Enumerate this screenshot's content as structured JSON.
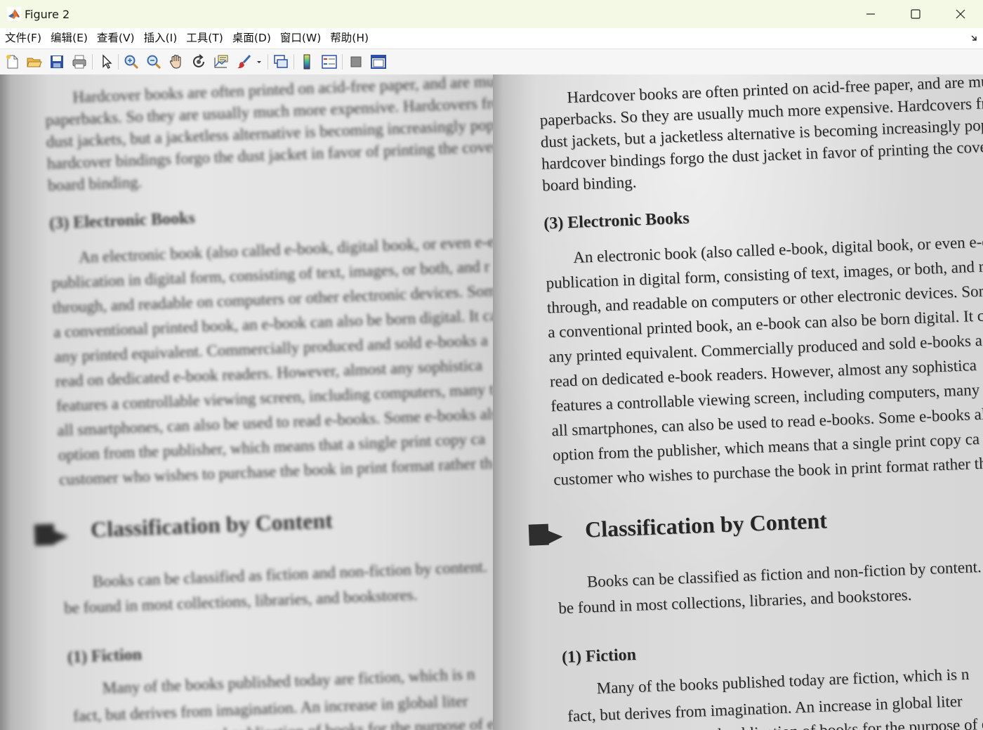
{
  "window": {
    "title": "Figure 2",
    "controls": [
      "minimize-icon",
      "maximize-icon",
      "close-icon"
    ]
  },
  "menu": {
    "items": [
      "文件(F)",
      "编辑(E)",
      "查看(V)",
      "插入(I)",
      "工具(T)",
      "桌面(D)",
      "窗口(W)",
      "帮助(H)"
    ]
  },
  "toolbar": {
    "icons": [
      "new-figure-icon",
      "open-file-icon",
      "save-icon",
      "print-icon",
      "edit-plot-icon",
      "zoom-in-icon",
      "zoom-out-icon",
      "pan-icon",
      "rotate-3d-icon",
      "data-cursor-icon",
      "brush-icon",
      "link-plot-icon",
      "colorbar-icon",
      "legend-icon",
      "hide-plot-tools-icon",
      "show-plot-tools-icon"
    ]
  },
  "document": {
    "lines_top": [
      "Hardcover books are often printed on acid-free paper, and are much",
      "paperbacks. So they are usually much more expensive. Hardcovers frequent",
      "dust jackets, but a jacketless alternative is becoming increasingly popu",
      "hardcover bindings forgo the dust jacket in favor of printing the cover de",
      "board binding."
    ],
    "section_ebooks": "(3) Electronic Books",
    "lines_ebooks": [
      "An electronic book (also called e-book, digital book, or even e-e",
      "publication in digital form, consisting of text, images, or both, and r",
      "through, and readable on computers or other electronic devices. Som",
      "a conventional printed book, an e-book can also be born digital. It ca",
      "any printed equivalent. Commercially produced and sold e-books a",
      "read on dedicated e-book readers. However, almost any sophistica",
      "features a controllable viewing screen, including computers, many t",
      "all smartphones, can also be used to read e-books. Some e-books also",
      "option from the publisher, which means that a single print copy ca",
      "customer who wishes to purchase the book in print format rather th"
    ],
    "heading": "Classification by Content",
    "lines_class": [
      "Books can be classified as fiction and non-fiction by content.",
      "be found in most collections, libraries, and bookstores."
    ],
    "section_fiction": "(1) Fiction",
    "lines_fiction": [
      "Many of the books published today are fiction, which is n",
      "fact, but derives from imagination. An increase in global liter",
      "and publication of books for the purpose of enter"
    ]
  },
  "colors": {
    "title_bar": "#f4f9e6",
    "menu_bar": "#ffffff",
    "toolbar": "#f6f6f6"
  }
}
